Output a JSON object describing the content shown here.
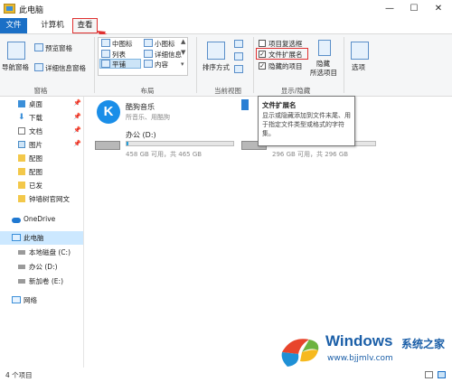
{
  "window": {
    "title": "此电脑",
    "minimize": "—",
    "maximize": "☐",
    "close": "✕"
  },
  "tabs": {
    "file": "文件",
    "computer": "计算机",
    "view": "查看"
  },
  "ribbon": {
    "pane_group": {
      "nav_pane": "导航窗格",
      "preview_pane": "预览窗格",
      "details_pane": "详细信息窗格",
      "label": "窗格"
    },
    "layout_group": {
      "medium_icons": "中图标",
      "small_icons": "小图标",
      "list": "列表",
      "details": "详细信息",
      "tiles": "平铺",
      "content": "内容",
      "label": "布局"
    },
    "current_view_group": {
      "sort_by": "排序方式",
      "label": "当前视图"
    },
    "show_hide_group": {
      "item_checkboxes": "项目复选框",
      "file_extensions": "文件扩展名",
      "hidden_items": "隐藏的项目",
      "hide_selected": "隐藏",
      "selected_items": "所选项目",
      "label": "显示/隐藏",
      "item_checkboxes_checked": false,
      "file_extensions_checked": true,
      "hidden_items_checked": true
    },
    "options": "选项"
  },
  "nav": {
    "quick_access": [
      {
        "label": "桌面",
        "pinned": true
      },
      {
        "label": "下载",
        "pinned": true
      },
      {
        "label": "文档",
        "pinned": true
      },
      {
        "label": "图片",
        "pinned": true
      },
      {
        "label": "配图"
      },
      {
        "label": "配图"
      },
      {
        "label": "已发"
      },
      {
        "label": "钟墙树官网文"
      }
    ],
    "onedrive": "OneDrive",
    "this_pc": "此电脑",
    "drives": [
      {
        "label": "本地磁盘 (C:)"
      },
      {
        "label": "办公 (D:)"
      },
      {
        "label": "新加卷 (E:)"
      }
    ],
    "network": "网络"
  },
  "content": {
    "app": {
      "name": "酷狗音乐",
      "sub": "所音乐、用酷狗"
    },
    "drive_d": {
      "name": "办公 (D:)",
      "free": "458 GB 可用，共 465 GB",
      "used_fraction": 0.015
    },
    "drive_e": {
      "free": "296 GB 可用，共 296 GB",
      "used_fraction": 0.004
    }
  },
  "tooltip": {
    "title": "文件扩展名",
    "body": "显示或隐藏添加到文件末尾、用于指定文件类型或格式的字符集。"
  },
  "status": {
    "count": "4 个项目"
  },
  "watermark": {
    "title": "Windows",
    "sub": "系统之家",
    "url": "www.bjjmlv.com"
  },
  "colors": {
    "accent": "#1a6fc6",
    "highlight": "#e03030",
    "progress": "#26a0da"
  }
}
